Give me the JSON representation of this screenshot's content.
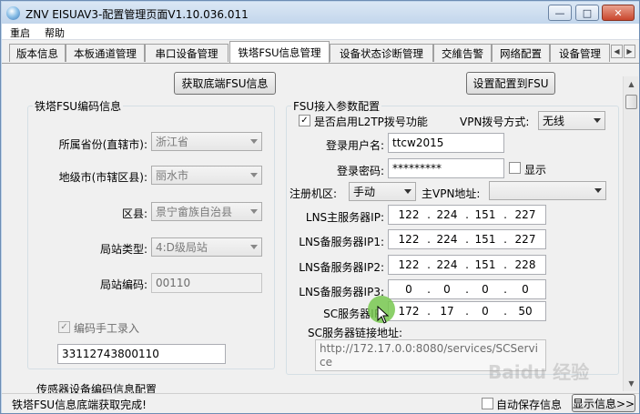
{
  "window": {
    "title": "ZNV EISUAV3-配置管理页面V1.10.036.011",
    "buttons": {
      "minimize": "—",
      "maximize": "□",
      "close": "✕"
    }
  },
  "menu": {
    "items": [
      "重启",
      "帮助"
    ]
  },
  "tabs": [
    {
      "label": "版本信息",
      "active": false
    },
    {
      "label": "本板通道管理",
      "active": false
    },
    {
      "label": "串口设备管理",
      "active": false
    },
    {
      "label": "铁塔FSU信息管理",
      "active": true
    },
    {
      "label": "设备状态诊断管理",
      "active": false
    },
    {
      "label": "交維告警",
      "active": false
    },
    {
      "label": "网络配置",
      "active": false
    },
    {
      "label": "设备管理",
      "active": false
    }
  ],
  "tab_scroll": {
    "left": "◀",
    "right": "▶"
  },
  "toolbar": {
    "get_fsu_button": "获取底端FSU信息",
    "set_config_button": "设置配置到FSU"
  },
  "fsu_code": {
    "group_title": "铁塔FSU编码信息",
    "province_label": "所属省份(直辖市):",
    "province_value": "浙江省",
    "city_label": "地级市(市辖区县):",
    "city_value": "丽水市",
    "county_label": "区县:",
    "county_value": "景宁畲族自治县",
    "site_type_label": "局站类型:",
    "site_type_value": "4:D级局站",
    "site_code_label": "局站编码:",
    "site_code_value": "00110",
    "manual_entry_label": "编码手工录入",
    "manual_entry_checked": true,
    "fsu_code_value": "33112743800110"
  },
  "fsu_access": {
    "group_title": "FSU接入参数配置",
    "l2tp_label": "是否启用L2TP拨号功能",
    "l2tp_checked": true,
    "vpn_mode_label": "VPN拨号方式:",
    "vpn_mode_value": "无线",
    "username_label": "登录用户名:",
    "username_value": "ttcw2015",
    "password_label": "登录密码:",
    "password_value": "*********",
    "show_label": "显示",
    "show_checked": false,
    "register_label": "注册机区:",
    "register_value": "手动",
    "main_vpn_label": "主VPN地址:",
    "main_vpn_value": "",
    "lns_main_label": "LNS主服务器IP:",
    "lns_main_ip": [
      "122",
      "224",
      "151",
      "227"
    ],
    "lns_backup1_label": "LNS备服务器IP1:",
    "lns_backup1_ip": [
      "122",
      "224",
      "151",
      "227"
    ],
    "lns_backup2_label": "LNS备服务器IP2:",
    "lns_backup2_ip": [
      "122",
      "224",
      "151",
      "228"
    ],
    "lns_backup3_label": "LNS备服务器IP3:",
    "lns_backup3_ip": [
      "0",
      "0",
      "0",
      "0"
    ],
    "sc_server_label": "SC服务器IP:",
    "sc_server_ip": [
      "172",
      "17",
      "0",
      "50"
    ],
    "sc_link_label": "SC服务器链接地址:",
    "sc_link_value": "http://172.17.0.0:8080/services/SCService"
  },
  "sensor_section": {
    "title": "传感器设备编码信息配置"
  },
  "status": {
    "message": "铁塔FSU信息底端获取完成!",
    "autosave_label": "自动保存信息",
    "autosave_checked": false,
    "show_info_button": "显示信息>>"
  },
  "watermark": "Baidu 经验",
  "icons": [
    "app-icon",
    "minimize-icon",
    "maximize-icon",
    "close-icon",
    "dropdown-arrow-icon",
    "scroll-up-icon",
    "scroll-down-icon",
    "tab-left-icon",
    "tab-right-icon"
  ]
}
